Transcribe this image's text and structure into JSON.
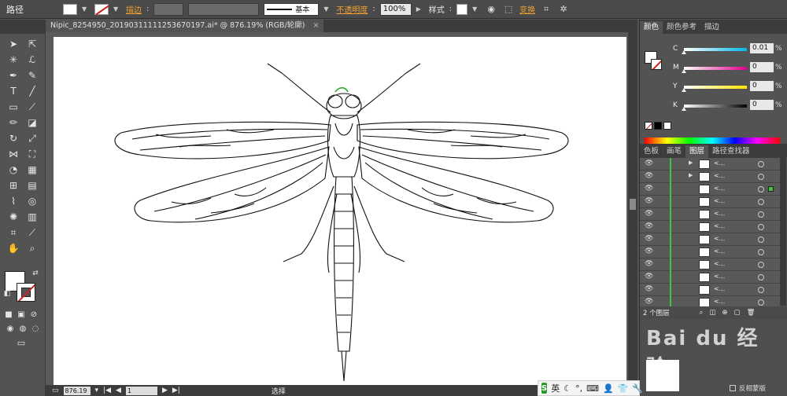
{
  "control_bar": {
    "selection_label": "路径",
    "stroke_label": "描边",
    "stroke_profile": "基本",
    "opacity_label": "不透明度",
    "opacity_value": "100%",
    "style_label": "样式",
    "transform_label": "变换"
  },
  "document": {
    "tab_title": "Nipic_8254950_20190311111253670197.ai* @ 876.19% (RGB/轮廓)",
    "close_glyph": "×"
  },
  "status_bar": {
    "zoom": "876.19",
    "page": "1",
    "mode": "选择"
  },
  "color_panel": {
    "tabs": [
      "颜色",
      "颜色参考",
      "描边"
    ],
    "channels": [
      {
        "label": "C",
        "value": "0.01",
        "level": 0.0001,
        "color": "#00b7eb"
      },
      {
        "label": "M",
        "value": "0",
        "level": 0,
        "color": "#e0008a"
      },
      {
        "label": "Y",
        "value": "0",
        "level": 0,
        "color": "#ffe600"
      },
      {
        "label": "K",
        "value": "0",
        "level": 0,
        "color": "#000000"
      }
    ],
    "percent": "%"
  },
  "layers_panel": {
    "tabs": [
      "色板",
      "画笔",
      "图层",
      "路径查找器"
    ],
    "row_name": "<...",
    "count_label": "2 个图层"
  },
  "bottom_panel": {
    "watermark": "Bai du 经验",
    "invert_label": "反相蒙版"
  },
  "ime": {
    "logo": "S",
    "lang": "英"
  },
  "icons": {
    "eye": "👁",
    "expand": "▶"
  }
}
